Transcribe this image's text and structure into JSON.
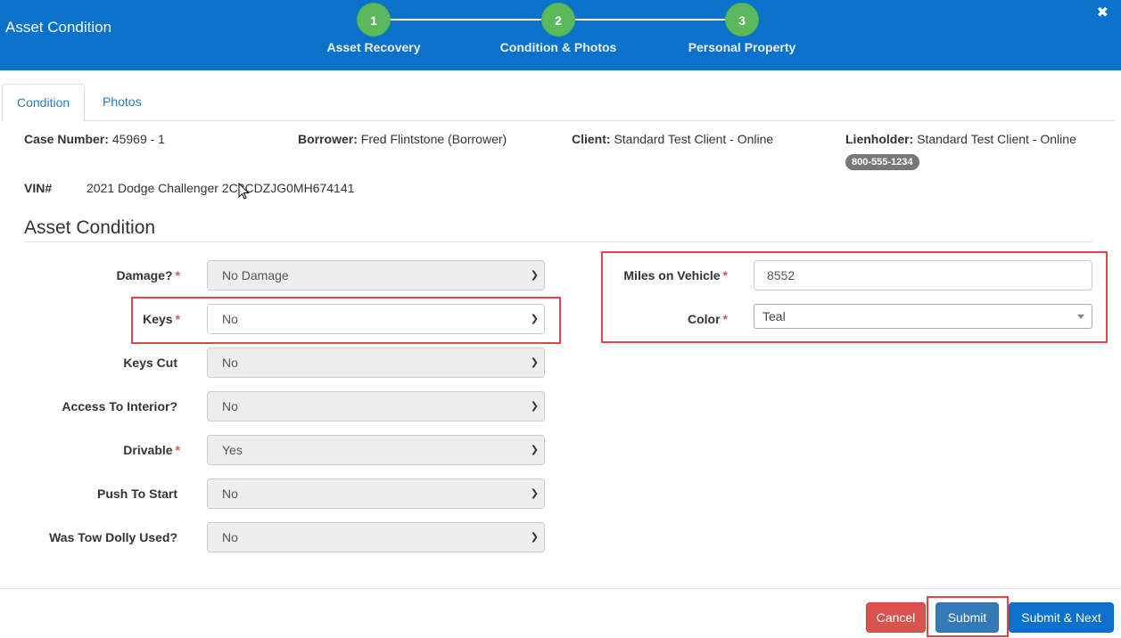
{
  "header": {
    "title": "Asset Condition",
    "close_glyph": "✖",
    "steps": [
      {
        "number": "1",
        "label": "Asset Recovery"
      },
      {
        "number": "2",
        "label": "Condition & Photos"
      },
      {
        "number": "3",
        "label": "Personal Property"
      }
    ]
  },
  "tabs": [
    {
      "label": "Condition",
      "active": true
    },
    {
      "label": "Photos",
      "active": false
    }
  ],
  "info": {
    "case_label": "Case Number:",
    "case_value": "45969 - 1",
    "borrower_label": "Borrower:",
    "borrower_value": "Fred Flintstone (Borrower)",
    "client_label": "Client:",
    "client_value": "Standard Test Client - Online",
    "lienholder_label": "Lienholder:",
    "lienholder_value": "Standard Test Client - Online",
    "lienholder_phone": "800-555-1234",
    "vin_label": "VIN#",
    "vin_value": "2021 Dodge Challenger 2C3CDZJG0MH674141"
  },
  "section_title": "Asset Condition",
  "form_left": [
    {
      "label": "Damage?",
      "required": "*",
      "value": "No Damage"
    },
    {
      "label": "Keys",
      "required": "*",
      "value": "No"
    },
    {
      "label": "Keys Cut",
      "required": "",
      "value": "No"
    },
    {
      "label": "Access To Interior?",
      "required": "",
      "value": "No"
    },
    {
      "label": "Drivable",
      "required": "*",
      "value": "Yes"
    },
    {
      "label": "Push To Start",
      "required": "",
      "value": "No"
    },
    {
      "label": "Was Tow Dolly Used?",
      "required": "",
      "value": "No"
    }
  ],
  "form_right": {
    "miles_label": "Miles on Vehicle",
    "miles_required": "*",
    "miles_value": "8552",
    "color_label": "Color",
    "color_required": "*",
    "color_value": "Teal"
  },
  "footer": {
    "cancel_label": "Cancel",
    "submit_label": "Submit",
    "submit_next_label": "Submit & Next"
  },
  "colors": {
    "header_bg": "#0b72cc",
    "step_green": "#5cb85c",
    "required_red": "#d9534f",
    "highlight_red": "#e0474c",
    "cancel_red": "#d9534f",
    "submit_blue": "#337ab7"
  }
}
